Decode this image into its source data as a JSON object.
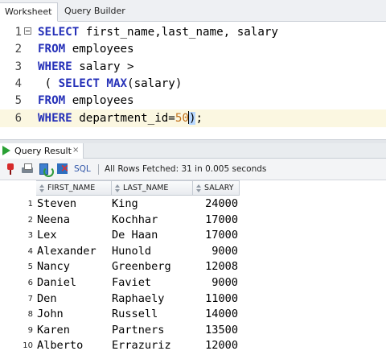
{
  "tabs": {
    "worksheet": "Worksheet",
    "query_builder": "Query Builder"
  },
  "editor": {
    "lines": [
      {
        "n": "1",
        "tokens": [
          {
            "t": "SELECT",
            "k": "kw"
          },
          {
            "t": " first_name,last_name, salary",
            "k": ""
          }
        ]
      },
      {
        "n": "2",
        "tokens": [
          {
            "t": "FROM",
            "k": "kw"
          },
          {
            "t": " employees",
            "k": ""
          }
        ]
      },
      {
        "n": "3",
        "tokens": [
          {
            "t": "WHERE",
            "k": "kw"
          },
          {
            "t": " salary >",
            "k": ""
          }
        ]
      },
      {
        "n": "4",
        "tokens": [
          {
            "t": " ( ",
            "k": ""
          },
          {
            "t": "SELECT",
            "k": "kw"
          },
          {
            "t": " ",
            "k": ""
          },
          {
            "t": "MAX",
            "k": "kw"
          },
          {
            "t": "(salary)",
            "k": ""
          }
        ]
      },
      {
        "n": "5",
        "tokens": [
          {
            "t": "FROM",
            "k": "kw"
          },
          {
            "t": " employees",
            "k": ""
          }
        ]
      },
      {
        "n": "6",
        "tokens": [
          {
            "t": "WHERE",
            "k": "kw"
          },
          {
            "t": " department_id=",
            "k": ""
          },
          {
            "t": "50",
            "k": "num"
          },
          {
            "t": ")",
            "k": "caret"
          },
          {
            "t": ";",
            "k": ""
          }
        ]
      }
    ]
  },
  "results": {
    "tab_label": "Query Result",
    "tab_close": "×",
    "sql_label": "SQL",
    "status": "All Rows Fetched: 31 in 0.005 seconds",
    "columns": [
      "FIRST_NAME",
      "LAST_NAME",
      "SALARY"
    ],
    "rows": [
      [
        "1",
        "Steven",
        "King",
        "24000"
      ],
      [
        "2",
        "Neena",
        "Kochhar",
        "17000"
      ],
      [
        "3",
        "Lex",
        "De Haan",
        "17000"
      ],
      [
        "4",
        "Alexander",
        "Hunold",
        "9000"
      ],
      [
        "5",
        "Nancy",
        "Greenberg",
        "12008"
      ],
      [
        "6",
        "Daniel",
        "Faviet",
        "9000"
      ],
      [
        "7",
        "Den",
        "Raphaely",
        "11000"
      ],
      [
        "8",
        "John",
        "Russell",
        "14000"
      ],
      [
        "9",
        "Karen",
        "Partners",
        "13500"
      ],
      [
        "10",
        "Alberto",
        "Errazuriz",
        "12000"
      ]
    ]
  },
  "colors": {
    "keyword": "#2530b8",
    "number": "#c0701a",
    "current_line": "#fbf7e1",
    "run_icon": "#2aa034"
  }
}
